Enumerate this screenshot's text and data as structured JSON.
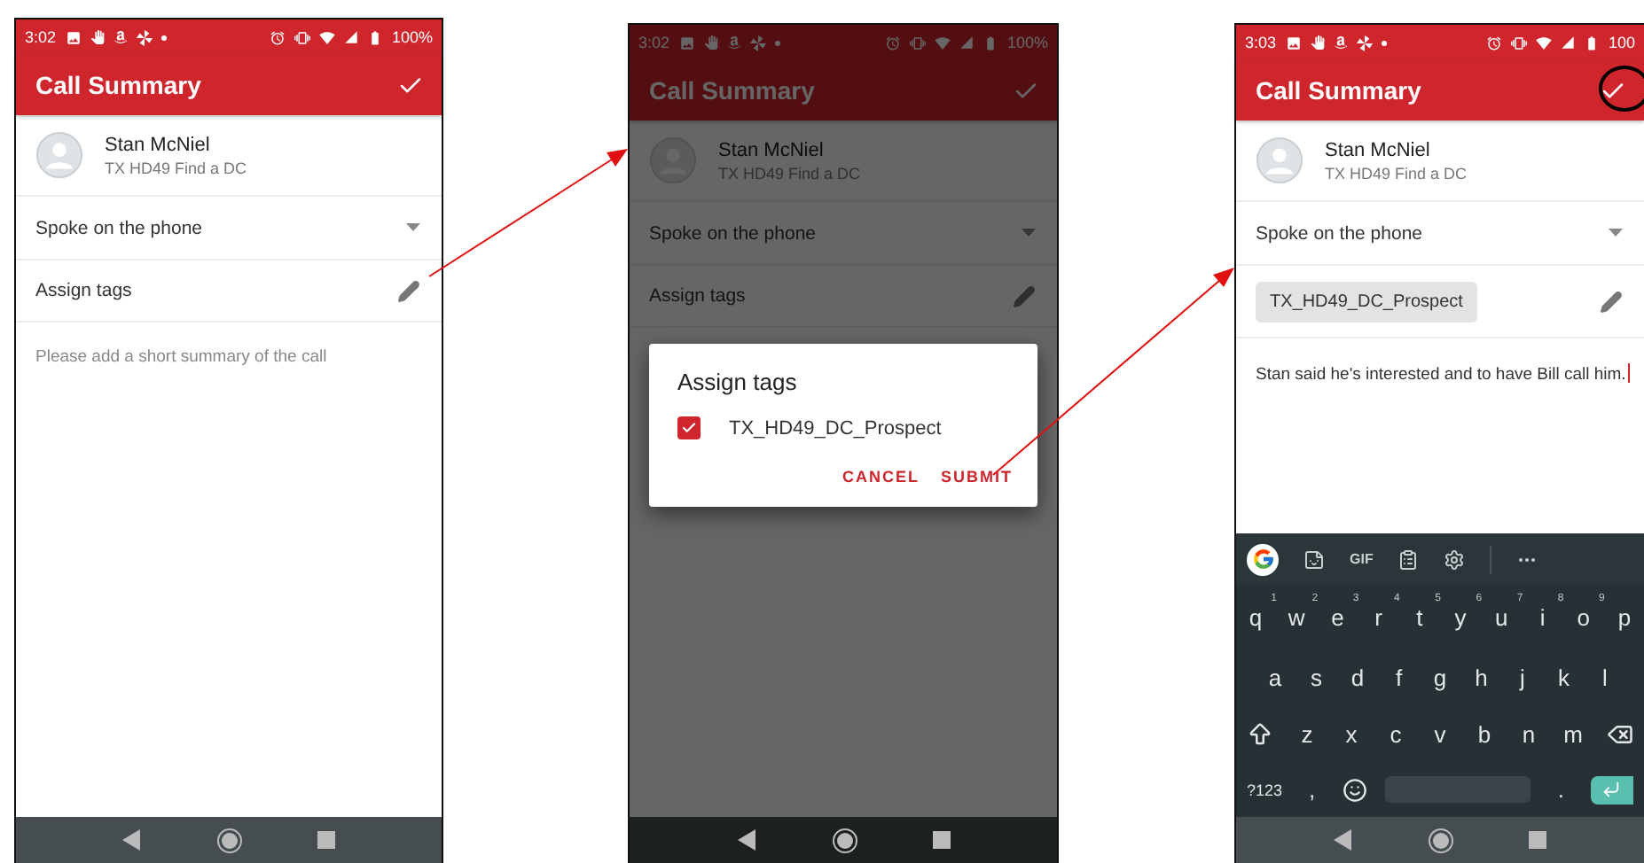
{
  "screens": [
    {
      "status": {
        "time": "3:02",
        "battery": "100%"
      },
      "title": "Call Summary",
      "dimmed": false,
      "confirm_circled": false,
      "contact": {
        "name": "Stan McNiel",
        "subtitle": "TX HD49 Find a DC"
      },
      "outcome": "Spoke on the phone",
      "tags": {
        "label": "Assign tags"
      },
      "summary": {
        "placeholder": "Please add a short summary of the call"
      }
    },
    {
      "status": {
        "time": "3:02",
        "battery": "100%"
      },
      "title": "Call Summary",
      "dimmed": true,
      "confirm_circled": false,
      "contact": {
        "name": "Stan McNiel",
        "subtitle": "TX HD49 Find a DC"
      },
      "outcome": "Spoke on the phone",
      "tags": {
        "label": "Assign tags"
      },
      "dialog": {
        "title": "Assign tags",
        "options": [
          {
            "label": "TX_HD49_DC_Prospect",
            "checked": true
          }
        ],
        "buttons": [
          "CANCEL",
          "SUBMIT"
        ]
      }
    },
    {
      "status": {
        "time": "3:03",
        "battery": "100"
      },
      "title": "Call Summary",
      "dimmed": false,
      "confirm_circled": true,
      "contact": {
        "name": "Stan McNiel",
        "subtitle": "TX HD49 Find a DC"
      },
      "outcome": "Spoke on the phone",
      "tags": {
        "chips": [
          "TX_HD49_DC_Prospect"
        ]
      },
      "summary": {
        "value": "Stan said he's interested and to have Bill call him."
      },
      "keyboard": {
        "toolbar": {
          "gif": "GIF"
        },
        "rows": [
          {
            "keys": [
              {
                "kind": "letter",
                "label": "q",
                "hint": "1"
              },
              {
                "kind": "letter",
                "label": "w",
                "hint": "2"
              },
              {
                "kind": "letter",
                "label": "e",
                "hint": "3"
              },
              {
                "kind": "letter",
                "label": "r",
                "hint": "4"
              },
              {
                "kind": "letter",
                "label": "t",
                "hint": "5"
              },
              {
                "kind": "letter",
                "label": "y",
                "hint": "6"
              },
              {
                "kind": "letter",
                "label": "u",
                "hint": "7"
              },
              {
                "kind": "letter",
                "label": "i",
                "hint": "8"
              },
              {
                "kind": "letter",
                "label": "o",
                "hint": "9"
              },
              {
                "kind": "letter",
                "label": "p"
              }
            ]
          },
          {
            "keys": [
              {
                "kind": "letter",
                "label": "a"
              },
              {
                "kind": "letter",
                "label": "s"
              },
              {
                "kind": "letter",
                "label": "d"
              },
              {
                "kind": "letter",
                "label": "f"
              },
              {
                "kind": "letter",
                "label": "g"
              },
              {
                "kind": "letter",
                "label": "h"
              },
              {
                "kind": "letter",
                "label": "j"
              },
              {
                "kind": "letter",
                "label": "k"
              },
              {
                "kind": "letter",
                "label": "l"
              }
            ]
          },
          {
            "keys": [
              {
                "kind": "shift"
              },
              {
                "kind": "letter",
                "label": "z"
              },
              {
                "kind": "letter",
                "label": "x"
              },
              {
                "kind": "letter",
                "label": "c"
              },
              {
                "kind": "letter",
                "label": "v"
              },
              {
                "kind": "letter",
                "label": "b"
              },
              {
                "kind": "letter",
                "label": "n"
              },
              {
                "kind": "letter",
                "label": "m"
              },
              {
                "kind": "backspace"
              }
            ]
          },
          {
            "keys": [
              {
                "kind": "symbols",
                "label": "?123"
              },
              {
                "kind": "letter",
                "label": ","
              },
              {
                "kind": "emoji"
              },
              {
                "kind": "space"
              },
              {
                "kind": "letter",
                "label": "."
              },
              {
                "kind": "enter"
              }
            ]
          }
        ]
      }
    }
  ]
}
